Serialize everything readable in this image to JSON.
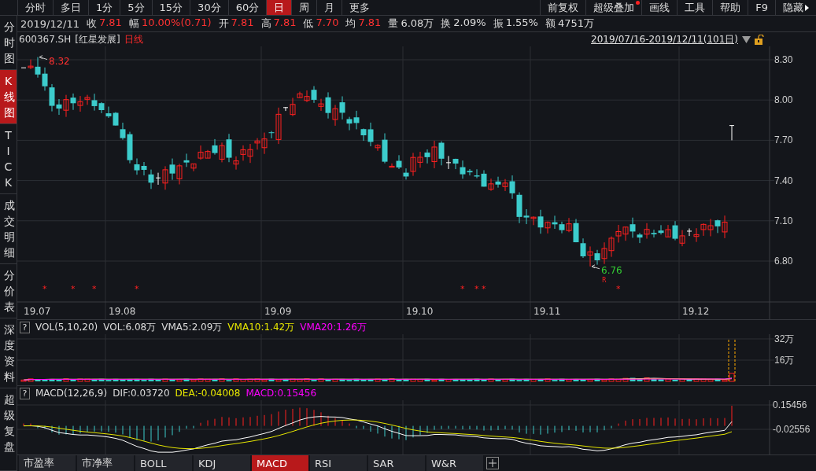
{
  "toolbar": {
    "periods": [
      {
        "label": "分时",
        "selected": false
      },
      {
        "label": "多日",
        "selected": false
      },
      {
        "label": "1分",
        "selected": false
      },
      {
        "label": "5分",
        "selected": false
      },
      {
        "label": "15分",
        "selected": false
      },
      {
        "label": "30分",
        "selected": false
      },
      {
        "label": "60分",
        "selected": false
      },
      {
        "label": "日",
        "selected": true
      },
      {
        "label": "周",
        "selected": false
      },
      {
        "label": "月",
        "selected": false
      },
      {
        "label": "更多",
        "selected": false
      }
    ],
    "actions": [
      {
        "label": "前复权",
        "badge": false,
        "kind": "button"
      },
      {
        "label": "超级叠加",
        "badge": true,
        "kind": "button"
      },
      {
        "label": "画线",
        "badge": false,
        "kind": "button"
      },
      {
        "label": "工具",
        "badge": false,
        "kind": "button"
      },
      {
        "label": "帮助",
        "badge": false,
        "kind": "button"
      },
      {
        "label": "F9",
        "badge": false,
        "kind": "button"
      },
      {
        "label": "隐藏",
        "badge": false,
        "kind": "menu"
      }
    ]
  },
  "sidebar": {
    "items": [
      {
        "label": "分时图",
        "selected": false
      },
      {
        "label": "K线图",
        "selected": true
      },
      {
        "label": "TICK",
        "selected": false
      },
      {
        "label": "成交明细",
        "selected": false
      },
      {
        "label": "分价表",
        "selected": false
      },
      {
        "label": "深度资料",
        "selected": false
      },
      {
        "label": "超级复盘",
        "selected": false
      }
    ]
  },
  "quote": {
    "date": "2019/12/11",
    "fields": [
      {
        "label": "收",
        "value": "7.81",
        "kind": "up"
      },
      {
        "label": "幅",
        "value": "10.00%(0.71)",
        "kind": "up"
      },
      {
        "label": "开",
        "value": "7.81",
        "kind": "up"
      },
      {
        "label": "高",
        "value": "7.81",
        "kind": "up"
      },
      {
        "label": "低",
        "value": "7.70",
        "kind": "up"
      },
      {
        "label": "均",
        "value": "7.81",
        "kind": "up"
      },
      {
        "label": "量",
        "value": "6.08万",
        "kind": "plain"
      },
      {
        "label": "换",
        "value": "2.09%",
        "kind": "plain"
      },
      {
        "label": "振",
        "value": "1.55%",
        "kind": "plain"
      },
      {
        "label": "额",
        "value": "4751万",
        "kind": "plain"
      }
    ]
  },
  "chart_header": {
    "code": "600367.SH",
    "name": "[红星发展]",
    "period": "日线",
    "range": "2019/07/16-2019/12/11(101日)"
  },
  "price_chart": {
    "yticks": [
      "8.30",
      "8.00",
      "7.70",
      "7.40",
      "7.10",
      "6.80"
    ],
    "xlabels": [
      "19.07",
      "19.08",
      "19.09",
      "19.10",
      "19.11",
      "19.12"
    ],
    "annotations": [
      {
        "text": "8.32",
        "kind": "high"
      },
      {
        "text": "6.76",
        "kind": "low"
      }
    ],
    "markers": [
      {
        "text": "*",
        "kind": "star"
      },
      {
        "text": "*",
        "kind": "star"
      },
      {
        "text": "*",
        "kind": "star"
      },
      {
        "text": "*",
        "kind": "star"
      },
      {
        "text": "*",
        "kind": "star"
      },
      {
        "text": "*",
        "kind": "star"
      },
      {
        "text": "*",
        "kind": "star"
      },
      {
        "text": "R",
        "kind": "flag"
      },
      {
        "text": "*",
        "kind": "star"
      }
    ]
  },
  "volume": {
    "help": "?",
    "legend": [
      {
        "text": "VOL(5,10,20)",
        "color": "#dddddd"
      },
      {
        "text": "VOL:6.08万",
        "color": "#dddddd"
      },
      {
        "text": "VMA5:2.09万",
        "color": "#dddddd"
      },
      {
        "text": "VMA10:1.42万",
        "color": "#e6e600"
      },
      {
        "text": "VMA20:1.26万",
        "color": "#ff00ff"
      }
    ],
    "yticks": [
      "32万",
      "16万"
    ]
  },
  "macd": {
    "help": "?",
    "legend": [
      {
        "text": "MACD(12,26,9)",
        "color": "#dddddd"
      },
      {
        "text": "DIF:0.03720",
        "color": "#dddddd"
      },
      {
        "text": "DEA:-0.04008",
        "color": "#e6e600"
      },
      {
        "text": "MACD:0.15456",
        "color": "#ff00ff"
      }
    ],
    "yticks": [
      "0.15456",
      "-0.02556"
    ]
  },
  "indicator_tabs": [
    {
      "label": "市盈率",
      "selected": false
    },
    {
      "label": "市净率",
      "selected": false
    },
    {
      "label": "BOLL",
      "selected": false
    },
    {
      "label": "KDJ",
      "selected": false
    },
    {
      "label": "MACD",
      "selected": true
    },
    {
      "label": "RSI",
      "selected": false
    },
    {
      "label": "SAR",
      "selected": false
    },
    {
      "label": "W&R",
      "selected": false
    }
  ]
}
